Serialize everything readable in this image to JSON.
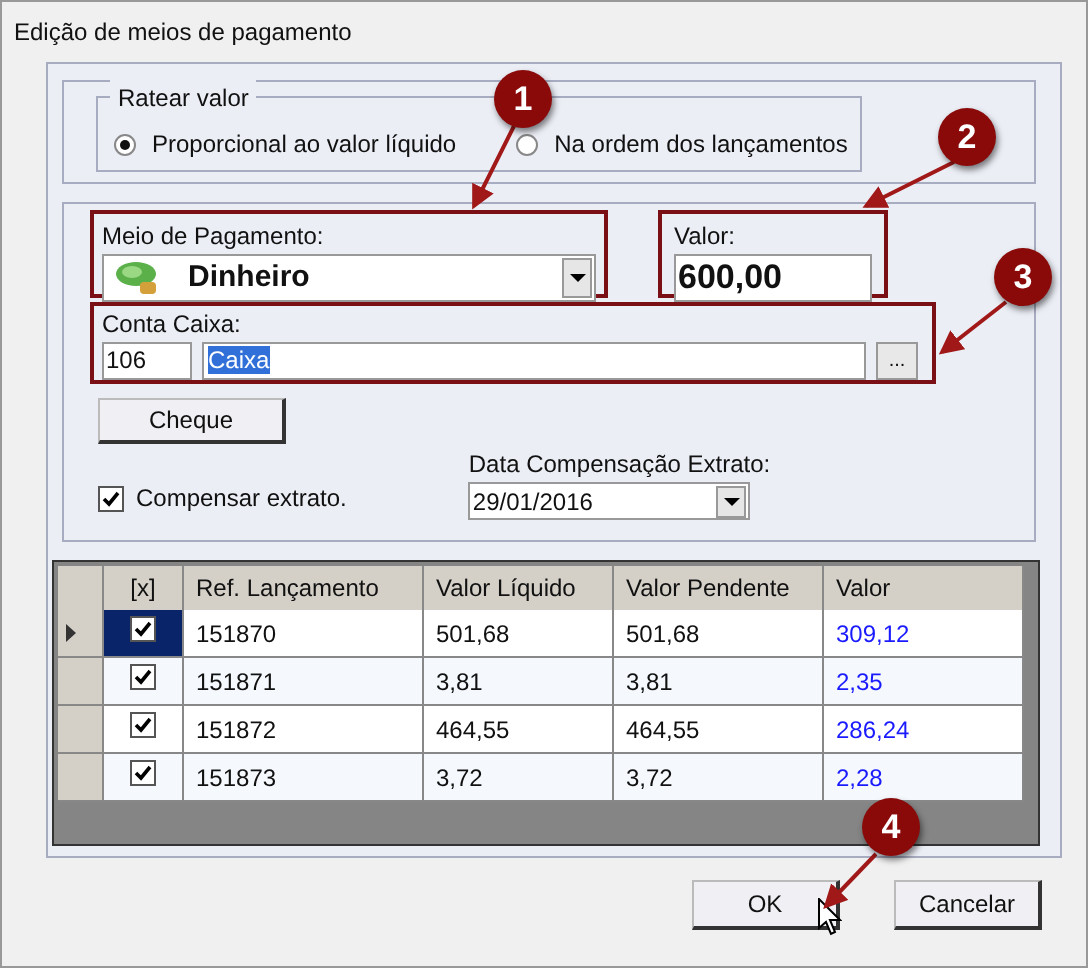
{
  "window": {
    "title": "Edição de meios de pagamento"
  },
  "ratear": {
    "legend": "Ratear valor",
    "options": [
      {
        "label": "Proporcional ao valor líquido",
        "selected": true
      },
      {
        "label": "Na ordem dos lançamentos",
        "selected": false
      }
    ]
  },
  "meio_pagamento": {
    "label": "Meio de Pagamento:",
    "value": "Dinheiro"
  },
  "valor": {
    "label": "Valor:",
    "value": "600,00"
  },
  "conta_caixa": {
    "label": "Conta Caixa:",
    "code": "106",
    "name": "Caixa",
    "browse": "..."
  },
  "cheque_button": "Cheque",
  "compensar": {
    "label": "Compensar extrato.",
    "checked": true
  },
  "data_compensacao": {
    "label": "Data Compensação Extrato:",
    "value": "29/01/2016"
  },
  "table": {
    "check_column": "[x]",
    "columns": [
      "Ref. Lançamento",
      "Valor Líquido",
      "Valor Pendente",
      "Valor"
    ],
    "rows": [
      {
        "selected": true,
        "checked": true,
        "cells": [
          "151870",
          "501,68",
          "501,68",
          "309,12"
        ]
      },
      {
        "selected": false,
        "checked": true,
        "cells": [
          "151871",
          "3,81",
          "3,81",
          "2,35"
        ]
      },
      {
        "selected": false,
        "checked": true,
        "cells": [
          "151872",
          "464,55",
          "464,55",
          "286,24"
        ]
      },
      {
        "selected": false,
        "checked": true,
        "cells": [
          "151873",
          "3,72",
          "3,72",
          "2,28"
        ]
      }
    ]
  },
  "buttons": [
    "OK",
    "Cancelar"
  ],
  "callouts": [
    "1",
    "2",
    "3",
    "4"
  ]
}
